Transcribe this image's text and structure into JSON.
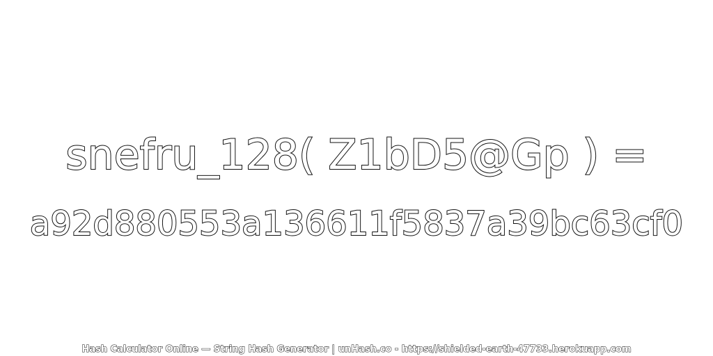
{
  "expression": "snefru_128( Z1bD5@Gp ) =",
  "hash_value": "a92d880553a136611f5837a39bc63cf0",
  "footer": "Hash Calculator Online — String Hash Generator | unHash.co - https://shielded-earth-47733.herokuapp.com",
  "colors": {
    "background": "#ffffff",
    "text_fill": "#ffffff",
    "text_outline": "#111111"
  }
}
